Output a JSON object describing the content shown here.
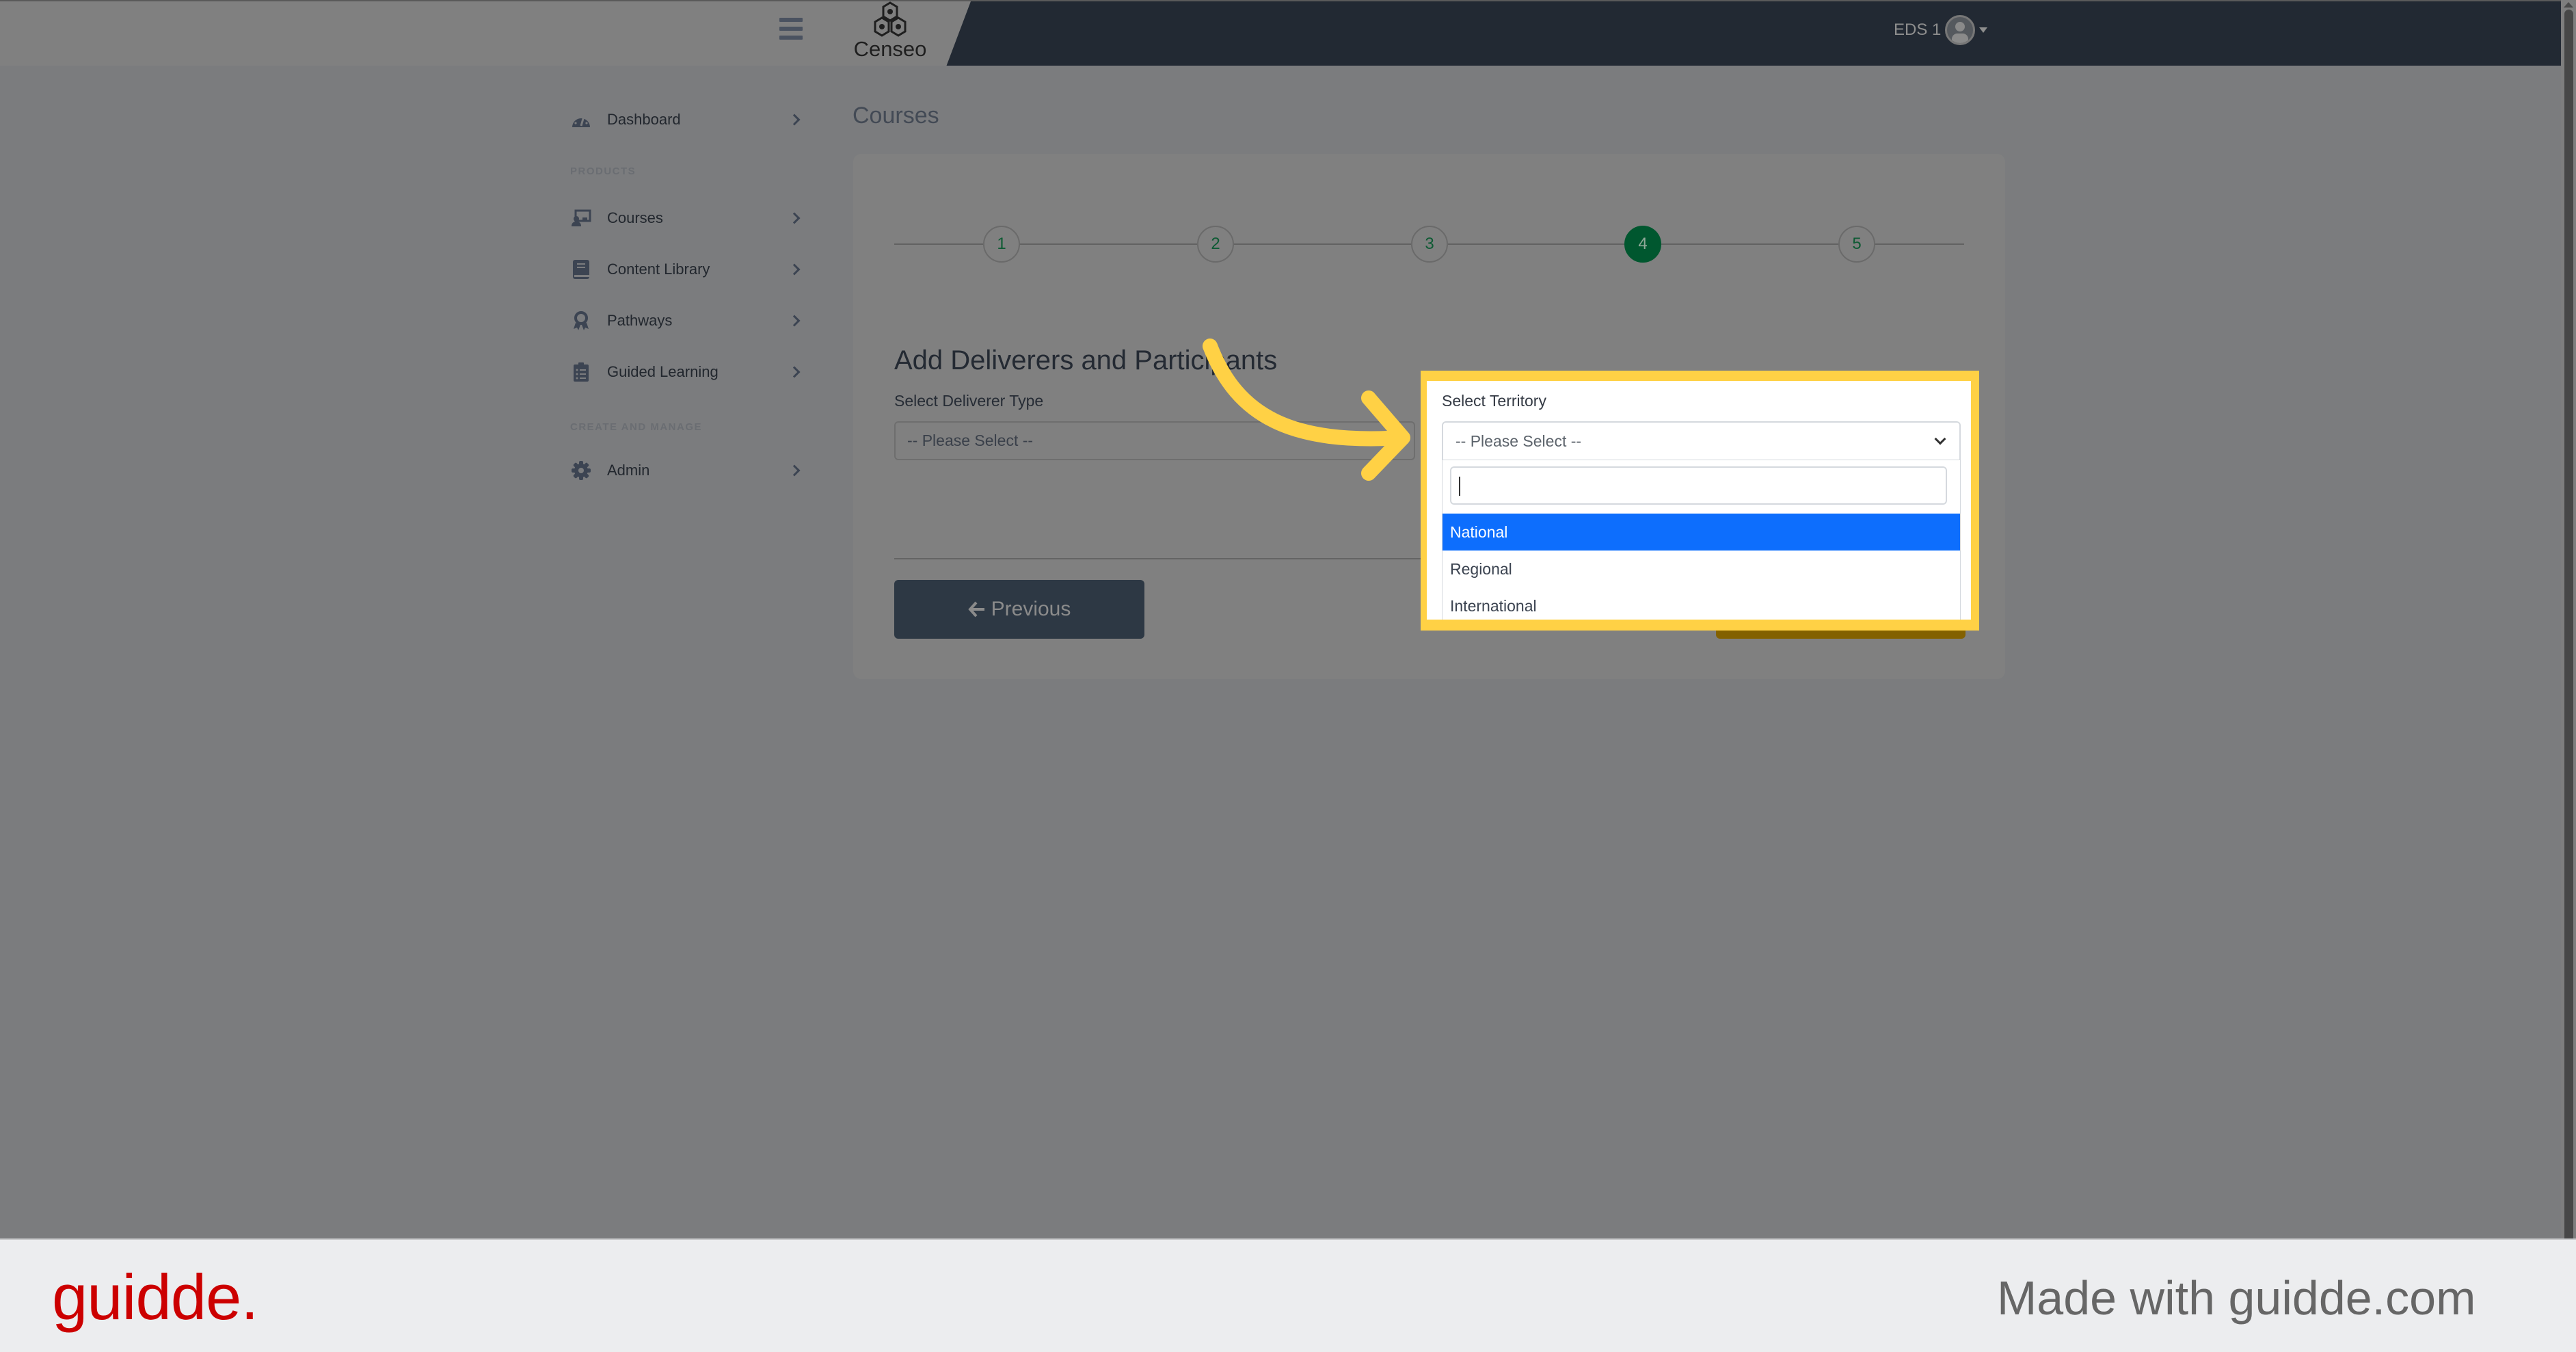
{
  "header": {
    "menu_icon": "hamburger-icon",
    "brand": "Censeo",
    "user_name": "EDS 1",
    "avatar_icon": "user-avatar-icon",
    "caret_icon": "caret-down-icon"
  },
  "sidebar": {
    "items": [
      {
        "label": "Dashboard",
        "icon": "dashboard-gauge-icon"
      },
      {
        "label": "Courses",
        "icon": "chalkboard-teacher-icon"
      },
      {
        "label": "Content Library",
        "icon": "book-icon"
      },
      {
        "label": "Pathways",
        "icon": "award-icon"
      },
      {
        "label": "Guided Learning",
        "icon": "clipboard-list-icon"
      },
      {
        "label": "Admin",
        "icon": "gear-icon"
      }
    ],
    "sections": [
      "PRODUCTS",
      "CREATE AND MANAGE"
    ]
  },
  "main": {
    "page_title": "Courses",
    "steps": [
      {
        "label": "1",
        "active": false
      },
      {
        "label": "2",
        "active": false
      },
      {
        "label": "3",
        "active": false
      },
      {
        "label": "4",
        "active": true
      },
      {
        "label": "5",
        "active": false
      }
    ],
    "section_heading": "Add Deliverers and Participants",
    "deliverer_type_label": "Select Deliverer Type",
    "deliverer_type_value": "-- Please Select --",
    "previous_button": "Previous",
    "previous_icon": "arrow-left-icon"
  },
  "territory_dropdown": {
    "label": "Select Territory",
    "value": "-- Please Select --",
    "search_value": "",
    "options": [
      {
        "label": "National",
        "highlighted": true
      },
      {
        "label": "Regional",
        "highlighted": false
      },
      {
        "label": "International",
        "highlighted": false
      }
    ],
    "highlight_color": "#0d6efd"
  },
  "annotation": {
    "highlight_color": "#ffd145"
  },
  "footer": {
    "brand": "guidde.",
    "made_with": "Made with guidde.com",
    "brand_color": "#cc0000"
  }
}
